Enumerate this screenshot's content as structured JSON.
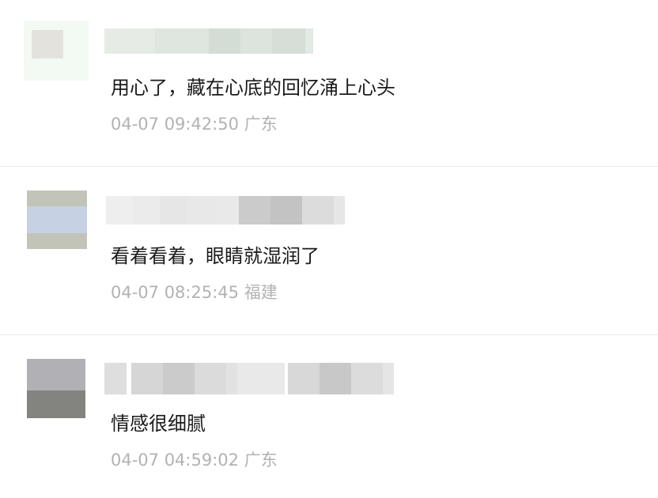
{
  "comments": [
    {
      "text": "用心了，藏在心底的回忆涌上心头",
      "time": "04-07 09:42:50",
      "location": "广东"
    },
    {
      "text": "看着看着，眼睛就湿润了",
      "time": "04-07 08:25:45",
      "location": "福建"
    },
    {
      "text": "情感很细腻",
      "time": "04-07 04:59:02",
      "location": "广东"
    }
  ],
  "colors": {
    "text": "#1a1a1a",
    "meta": "#b2b2b2",
    "divider": "#e9e9e9",
    "background": "#ffffff"
  }
}
